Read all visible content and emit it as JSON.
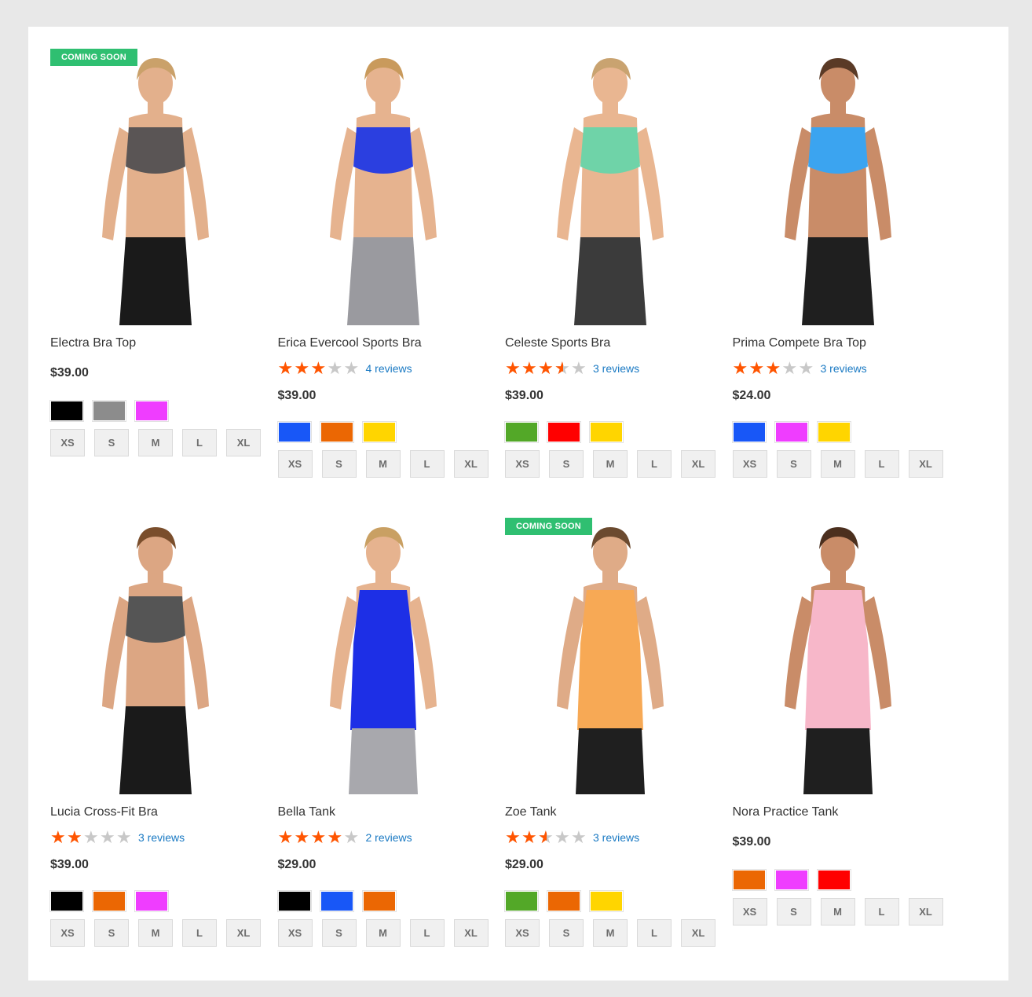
{
  "products": [
    {
      "name": "Electra Bra Top",
      "badge": "Coming Soon",
      "rating": null,
      "reviews": "",
      "price": "$39.00",
      "swatches": [
        "#000000",
        "#8c8c8c",
        "#ef3dff"
      ],
      "sizes": [
        "XS",
        "S",
        "M",
        "L",
        "XL"
      ],
      "top_color": "#5a5555",
      "bottom_color": "#1a1a1a",
      "skin": "#e3b08c",
      "hair": "#caa16a"
    },
    {
      "name": "Erica Evercool Sports Bra",
      "badge": "",
      "rating": 3,
      "reviews": "4 reviews",
      "price": "$39.00",
      "swatches": [
        "#1857f7",
        "#eb6703",
        "#ffd500"
      ],
      "sizes": [
        "XS",
        "S",
        "M",
        "L",
        "XL"
      ],
      "top_color": "#2b3fe0",
      "bottom_color": "#9a9a9f",
      "skin": "#e6b38f",
      "hair": "#c99a5c"
    },
    {
      "name": "Celeste Sports Bra",
      "badge": "",
      "rating": 3.5,
      "reviews": "3 reviews",
      "price": "$39.00",
      "swatches": [
        "#53a828",
        "#ff0000",
        "#ffd500"
      ],
      "sizes": [
        "XS",
        "S",
        "M",
        "L",
        "XL"
      ],
      "top_color": "#6fd3a8",
      "bottom_color": "#3b3b3b",
      "skin": "#e9b691",
      "hair": "#c9a370"
    },
    {
      "name": "Prima Compete Bra Top",
      "badge": "",
      "rating": 3,
      "reviews": "3 reviews",
      "price": "$24.00",
      "swatches": [
        "#1857f7",
        "#ef3dff",
        "#ffd500"
      ],
      "sizes": [
        "XS",
        "S",
        "M",
        "L",
        "XL"
      ],
      "top_color": "#3ba4f0",
      "bottom_color": "#1f1f1f",
      "skin": "#c98c68",
      "hair": "#5a3a26"
    },
    {
      "name": "Lucia Cross-Fit Bra",
      "badge": "",
      "rating": 2,
      "reviews": "3 reviews",
      "price": "$39.00",
      "swatches": [
        "#000000",
        "#eb6703",
        "#ef3dff"
      ],
      "sizes": [
        "XS",
        "S",
        "M",
        "L",
        "XL"
      ],
      "top_color": "#555555",
      "bottom_color": "#1a1a1a",
      "skin": "#dca683",
      "hair": "#7a4e2c"
    },
    {
      "name": "Bella Tank",
      "badge": "",
      "rating": 4,
      "reviews": "2 reviews",
      "price": "$29.00",
      "swatches": [
        "#000000",
        "#1857f7",
        "#eb6703"
      ],
      "sizes": [
        "XS",
        "S",
        "M",
        "L",
        "XL"
      ],
      "top_color": "#1d2fe6",
      "bottom_color": "#a8a8ad",
      "skin": "#e6b38f",
      "hair": "#c9a063"
    },
    {
      "name": "Zoe Tank",
      "badge": "Coming Soon",
      "rating": 2.5,
      "reviews": "3 reviews",
      "price": "$29.00",
      "swatches": [
        "#53a828",
        "#eb6703",
        "#ffd500"
      ],
      "sizes": [
        "XS",
        "S",
        "M",
        "L",
        "XL"
      ],
      "top_color": "#f7a955",
      "bottom_color": "#1f1f1f",
      "skin": "#dfab87",
      "hair": "#6b4a2f"
    },
    {
      "name": "Nora Practice Tank",
      "badge": "",
      "rating": null,
      "reviews": "",
      "price": "$39.00",
      "swatches": [
        "#eb6703",
        "#ef3dff",
        "#ff0000"
      ],
      "sizes": [
        "XS",
        "S",
        "M",
        "L",
        "XL"
      ],
      "top_color": "#f7b7c9",
      "bottom_color": "#1f1f1f",
      "skin": "#c98c68",
      "hair": "#4b2f1e"
    }
  ]
}
